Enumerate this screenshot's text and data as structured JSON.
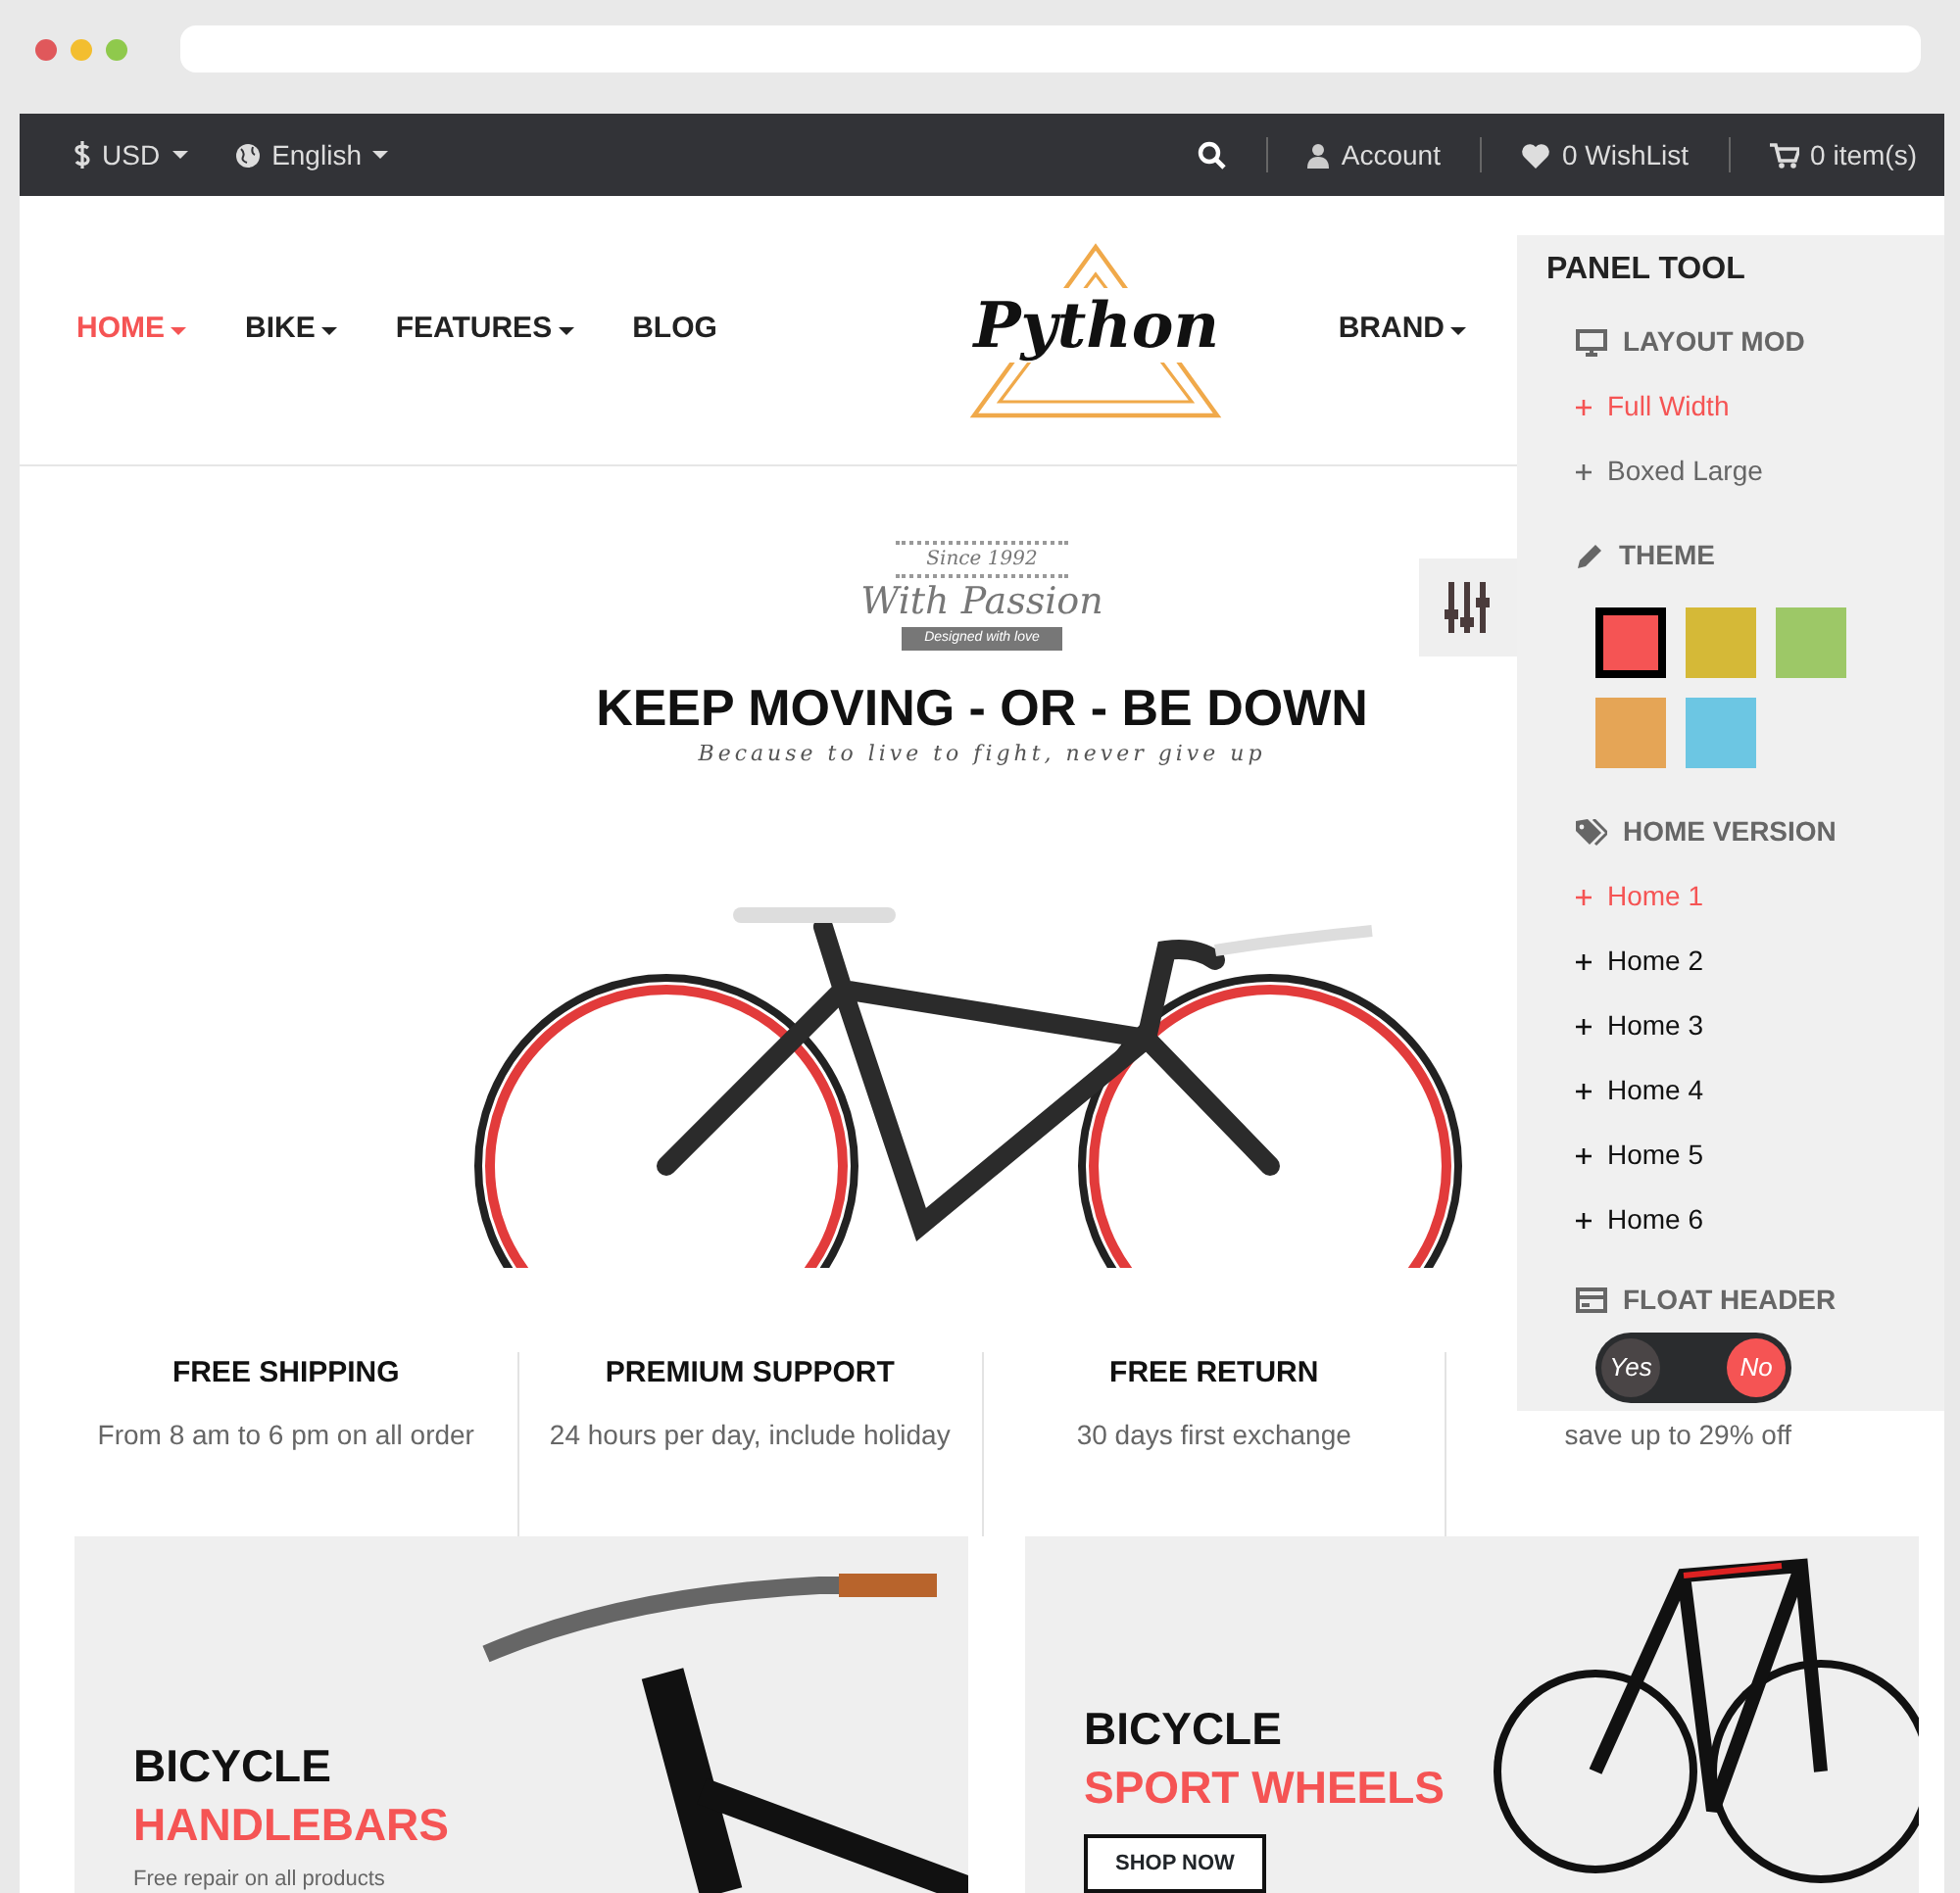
{
  "topbar": {
    "currency": "USD",
    "language": "English",
    "account": "Account",
    "wishlist": "0 WishList",
    "cart": "0 item(s)"
  },
  "nav": {
    "left": [
      {
        "label": "HOME",
        "selected": true
      },
      {
        "label": "BIKE",
        "selected": false
      },
      {
        "label": "FEATURES",
        "selected": false
      },
      {
        "label": "BLOG",
        "selected": false
      }
    ],
    "logo": "Python",
    "right": [
      {
        "label": "BRAND",
        "selected": false
      }
    ]
  },
  "hero": {
    "badge_top": "Since 1992",
    "badge_main": "With Passion",
    "badge_ribbon": "Designed with love",
    "title": "KEEP MOVING - OR - BE DOWN",
    "subtitle": "Because to live to fight, never give up"
  },
  "features": [
    {
      "title": "FREE SHIPPING",
      "text": "From 8 am to 6 pm on all order"
    },
    {
      "title": "PREMIUM SUPPORT",
      "text": "24 hours per day, include holiday"
    },
    {
      "title": "FREE RETURN",
      "text": "30 days first exchange"
    },
    {
      "text": "save up to 29% off"
    }
  ],
  "banners": [
    {
      "line1": "BICYCLE",
      "line2": "HANDLEBARS",
      "text": "Free repair on all products"
    },
    {
      "line1": "BICYCLE",
      "line2": "SPORT WHEELS",
      "button": "SHOP NOW"
    }
  ],
  "panel": {
    "title": "PANEL TOOL",
    "sections": [
      {
        "kind": "options",
        "title": "LAYOUT MOD",
        "items": [
          {
            "label": "Full Width",
            "selected": true
          },
          {
            "label": "Boxed Large",
            "selected": false
          }
        ]
      },
      {
        "kind": "swatches",
        "title": "THEME",
        "items": [
          {
            "color": "#f55454",
            "selected": true
          },
          {
            "color": "#d5b937",
            "selected": false
          },
          {
            "color": "#9dc867",
            "selected": false
          },
          {
            "color": "#e5a556",
            "selected": false
          },
          {
            "color": "#6cc6e3",
            "selected": false
          }
        ]
      },
      {
        "kind": "options",
        "title": "HOME VERSION",
        "items": [
          {
            "label": "Home 1",
            "selected": true
          },
          {
            "label": "Home 2",
            "selected": false
          },
          {
            "label": "Home 3",
            "selected": false
          },
          {
            "label": "Home 4",
            "selected": false
          },
          {
            "label": "Home 5",
            "selected": false
          },
          {
            "label": "Home 6",
            "selected": false
          }
        ]
      },
      {
        "kind": "toggle",
        "title": "FLOAT HEADER",
        "options": [
          {
            "label": "Yes",
            "selected": false
          },
          {
            "label": "No",
            "selected": true
          }
        ]
      }
    ]
  }
}
